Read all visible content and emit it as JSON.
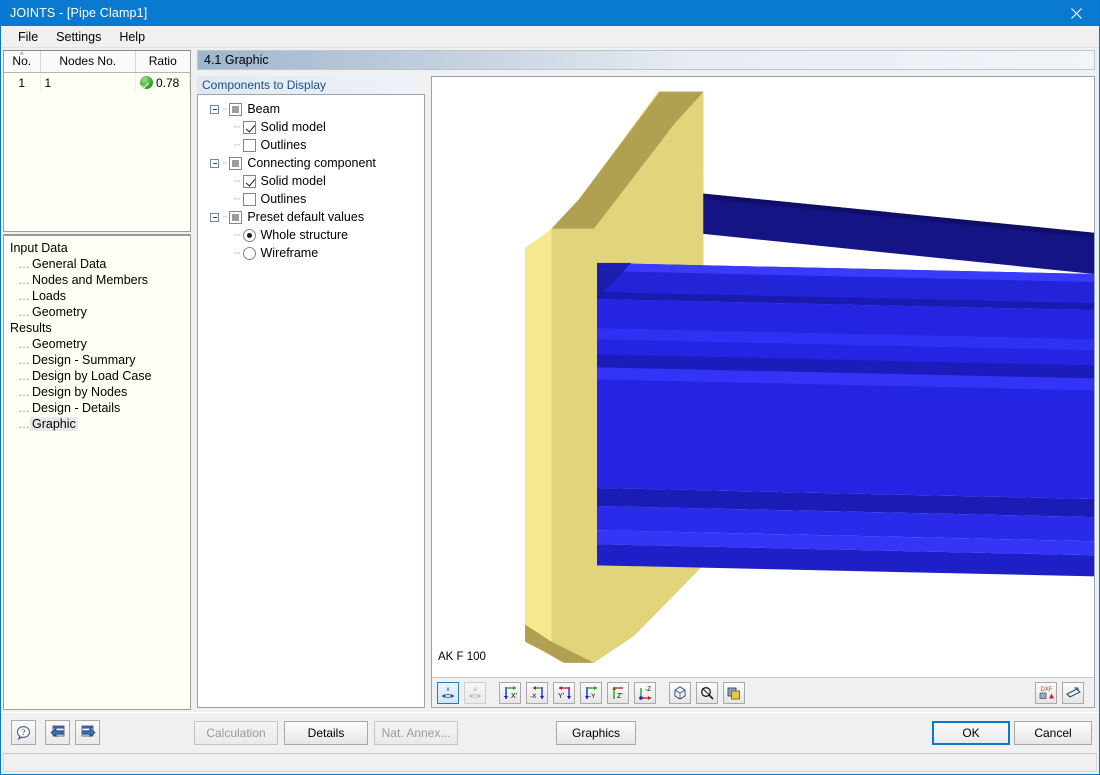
{
  "window": {
    "title": "JOINTS - [Pipe Clamp1]",
    "close_label": "close-icon"
  },
  "menu": {
    "items": [
      {
        "label": "File"
      },
      {
        "label": "Settings"
      },
      {
        "label": "Help"
      }
    ]
  },
  "grid": {
    "columns": [
      "No.",
      "Nodes No.",
      "Ratio"
    ],
    "rows": [
      {
        "no": "1",
        "nodes_no": "1",
        "ratio": "0.78",
        "status": "ok-check-icon"
      }
    ]
  },
  "navigation": {
    "groups": [
      {
        "label": "Input Data",
        "items": [
          {
            "label": "General Data",
            "selected": false
          },
          {
            "label": "Nodes and Members",
            "selected": false
          },
          {
            "label": "Loads",
            "selected": false
          },
          {
            "label": "Geometry",
            "selected": false
          }
        ]
      },
      {
        "label": "Results",
        "items": [
          {
            "label": "Geometry",
            "selected": false
          },
          {
            "label": "Design - Summary",
            "selected": false
          },
          {
            "label": "Design by Load Case",
            "selected": false
          },
          {
            "label": "Design by Nodes",
            "selected": false
          },
          {
            "label": "Design - Details",
            "selected": false
          },
          {
            "label": "Graphic",
            "selected": true
          }
        ]
      }
    ]
  },
  "section": {
    "header": "4.1 Graphic"
  },
  "components": {
    "tab_title": "Components to Display",
    "tree": [
      {
        "label": "Beam",
        "state": "partial",
        "children": [
          {
            "label": "Solid model",
            "type": "checkbox",
            "state": "checked"
          },
          {
            "label": "Outlines",
            "type": "checkbox",
            "state": "unchecked"
          }
        ]
      },
      {
        "label": "Connecting component",
        "state": "partial",
        "children": [
          {
            "label": "Solid model",
            "type": "checkbox",
            "state": "checked"
          },
          {
            "label": "Outlines",
            "type": "checkbox",
            "state": "unchecked"
          }
        ]
      },
      {
        "label": "Preset default values",
        "state": "partial",
        "children": [
          {
            "label": "Whole structure",
            "type": "radio",
            "state": "checked"
          },
          {
            "label": "Wireframe",
            "type": "radio",
            "state": "unchecked"
          }
        ]
      }
    ]
  },
  "graphic": {
    "model_label": "AK F 100",
    "colors": {
      "plate": "#e2d47a",
      "plate_light": "#f5e58f",
      "plate_dark": "#b8a954",
      "beam": "#2020e0",
      "beam_dark": "#15159b",
      "beam_light": "#3a3aff",
      "background": "#ffffff"
    },
    "toolbar": [
      {
        "name": "show-x-dimension-button",
        "icon": "dim-x-icon",
        "state": "active"
      },
      {
        "name": "show-a-dimension-button",
        "icon": "dim-a-icon",
        "state": "disabled"
      },
      {
        "name": "view-x-positive-button",
        "icon": "axis-x-icon",
        "state": "normal"
      },
      {
        "name": "view-x-negative-button",
        "icon": "axis-minus-x-icon",
        "state": "normal"
      },
      {
        "name": "view-y-positive-button",
        "icon": "axis-y-icon",
        "state": "normal"
      },
      {
        "name": "view-y-negative-button",
        "icon": "axis-minus-y-icon",
        "state": "normal"
      },
      {
        "name": "view-z-positive-button",
        "icon": "axis-z-icon",
        "state": "normal"
      },
      {
        "name": "view-z-negative-button",
        "icon": "axis-minus-z-icon",
        "state": "normal"
      },
      {
        "name": "isometric-view-button",
        "icon": "cube-icon",
        "state": "normal"
      },
      {
        "name": "zoom-view-button",
        "icon": "magnifier-icon",
        "state": "normal"
      },
      {
        "name": "render-mode-button",
        "icon": "layers-icon",
        "state": "normal"
      }
    ],
    "toolbar_right": [
      {
        "name": "export-dxf-button",
        "icon": "dxf-icon",
        "label": "DXF"
      },
      {
        "name": "print-button",
        "icon": "printer-icon"
      }
    ]
  },
  "footer": {
    "icons": [
      {
        "name": "help-button",
        "icon": "question-icon"
      },
      {
        "name": "previous-button",
        "icon": "arrow-left-icon"
      },
      {
        "name": "next-button",
        "icon": "arrow-right-icon"
      }
    ],
    "buttons": [
      {
        "label": "Calculation",
        "enabled": false
      },
      {
        "label": "Details",
        "enabled": true
      },
      {
        "label": "Nat. Annex...",
        "enabled": false
      },
      {
        "label": "Graphics",
        "enabled": true
      },
      {
        "label": "OK",
        "enabled": true,
        "focused": true
      },
      {
        "label": "Cancel",
        "enabled": true
      }
    ]
  }
}
